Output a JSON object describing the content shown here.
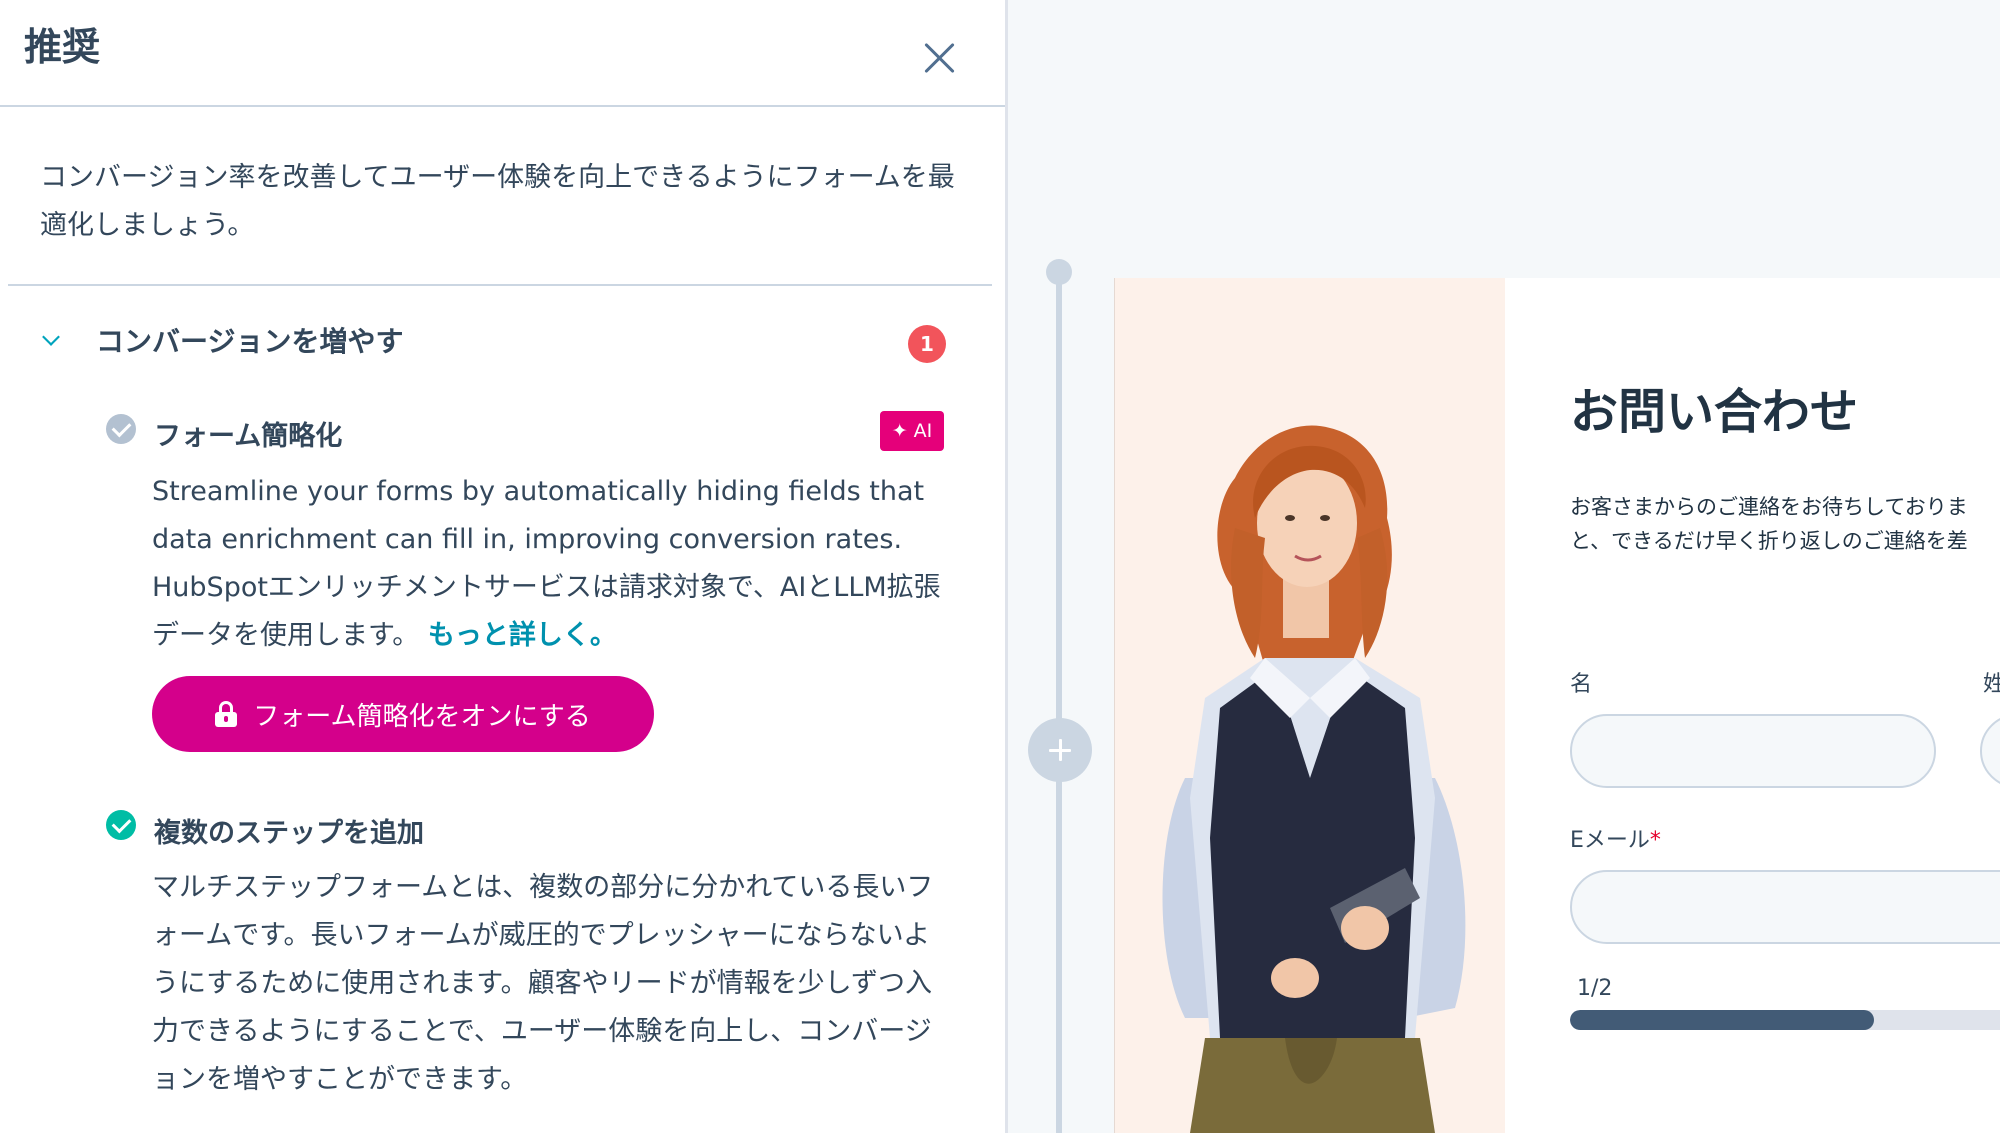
{
  "panel": {
    "title": "推奨",
    "intro": "コンバージョン率を改善してユーザー体験を向上できるようにフォームを最適化しましょう。",
    "section": {
      "title": "コンバージョンを増やす",
      "count": "1",
      "items": [
        {
          "title": "フォーム簡略化",
          "badge": "✦ AI",
          "body": "Streamline your forms by automatically hiding fields that data enrichment can fill in, improving conversion rates. HubSpotエンリッチメントサービスは請求対象で、AIとLLM拡張データを使用します。",
          "link": "もっと詳しく。",
          "button": "フォーム簡略化をオンにする",
          "status": "incomplete"
        },
        {
          "title": "複数のステップを追加",
          "body": "マルチステップフォームとは、複数の部分に分かれている長いフォームです。長いフォームが威圧的でプレッシャーにならないようにするために使用されます。顧客やリードが情報を少しずつ入力できるようにすることで、ユーザー体験を向上し、コンバージョンを増やすことができます。",
          "status": "complete"
        }
      ]
    }
  },
  "form_preview": {
    "title": "お問い合わせ",
    "description_line1": "お客さまからのご連絡をお待ちしておりま",
    "description_line2": "と、できるだけ早く折り返しのご連絡を差",
    "fields": {
      "first_name": "名",
      "last_name": "姓",
      "email": "Eメール",
      "email_required": "*"
    },
    "step": "1/2",
    "progress": 0.66
  },
  "colors": {
    "accent_pink": "#d4008b",
    "ai_badge": "#e5007a",
    "badge_red": "#f2545b",
    "check_green": "#00bda5",
    "link_teal": "#0091ae",
    "progress": "#425b76"
  }
}
